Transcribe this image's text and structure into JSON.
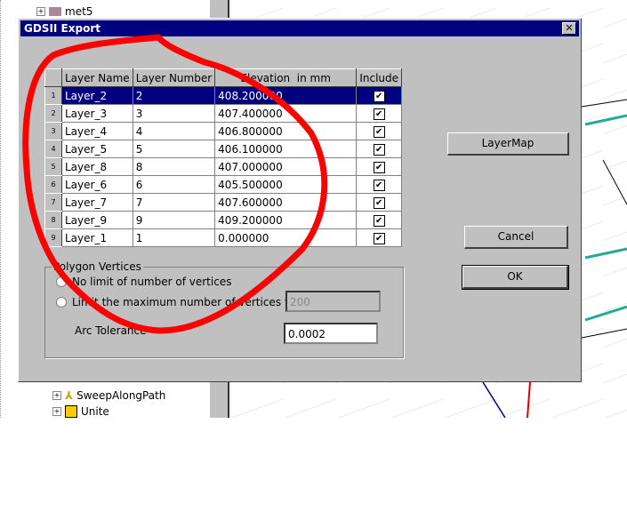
{
  "tree": {
    "items": [
      {
        "label": "met5"
      },
      {
        "label": "SweepAlongPath"
      },
      {
        "label": "Unite"
      }
    ]
  },
  "dialog": {
    "title": "GDSII Export",
    "table": {
      "headers": [
        "Layer Name",
        "Layer Number",
        "Elevation  in mm",
        "Include"
      ],
      "rows": [
        {
          "n": "1",
          "name": "Layer_2",
          "number": "2",
          "elevation": "408.200000",
          "include": true,
          "selected": true
        },
        {
          "n": "2",
          "name": "Layer_3",
          "number": "3",
          "elevation": "407.400000",
          "include": true
        },
        {
          "n": "3",
          "name": "Layer_4",
          "number": "4",
          "elevation": "406.800000",
          "include": true
        },
        {
          "n": "4",
          "name": "Layer_5",
          "number": "5",
          "elevation": "406.100000",
          "include": true
        },
        {
          "n": "5",
          "name": "Layer_8",
          "number": "8",
          "elevation": "407.000000",
          "include": true
        },
        {
          "n": "6",
          "name": "Layer_6",
          "number": "6",
          "elevation": "405.500000",
          "include": true
        },
        {
          "n": "7",
          "name": "Layer_7",
          "number": "7",
          "elevation": "407.600000",
          "include": true
        },
        {
          "n": "8",
          "name": "Layer_9",
          "number": "9",
          "elevation": "409.200000",
          "include": true
        },
        {
          "n": "9",
          "name": "Layer_1",
          "number": "1",
          "elevation": "0.000000",
          "include": true
        }
      ]
    },
    "polygon": {
      "group_label": "Polygon Vertices",
      "no_limit_label": "No limit of number of vertices",
      "limit_label": "Limit the maximum number of vertices to",
      "max_vertices": "200",
      "arc_label": "Arc Tolerance",
      "arc_value": "0.0002"
    },
    "buttons": {
      "layermap": "LayerMap",
      "cancel": "Cancel",
      "ok": "OK"
    }
  },
  "annotation_color": "#ff0000"
}
